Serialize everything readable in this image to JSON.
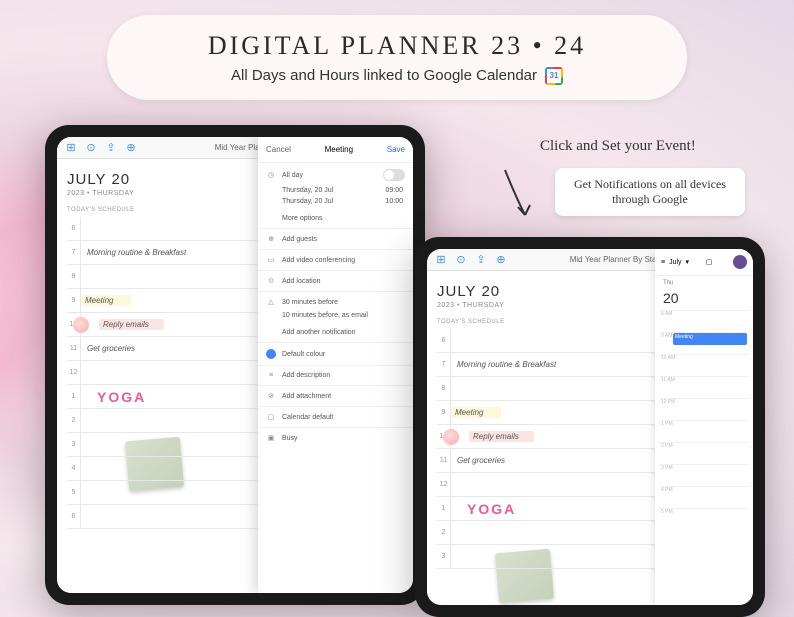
{
  "header": {
    "title": "DIGITAL PLANNER  23 • 24",
    "subtitle": "All Days and Hours linked to Google Calendar"
  },
  "callouts": {
    "click_set": "Click and Set your Event!",
    "notifications": "Get Notifications on all devices through Google"
  },
  "toolbar": {
    "app_title": "Mid Year Planner By Stay Planner"
  },
  "planner": {
    "date": "JULY 20",
    "date_sub": "2023 • THURSDAY",
    "schedule_label": "TODAY'S SCHEDULE",
    "hours": [
      "6",
      "7",
      "8",
      "9",
      "10",
      "11",
      "12",
      "1",
      "2",
      "3",
      "4",
      "5",
      "6"
    ],
    "tasks": {
      "7": "Morning routine & Breakfast",
      "9": "Meeting",
      "10": "Reply emails",
      "11": "Get groceries",
      "yoga": "YOGA"
    }
  },
  "modal": {
    "cancel": "Cancel",
    "title": "Meeting",
    "save": "Save",
    "all_day": "All day",
    "start": "Thursday, 20 Jul",
    "start_time": "09:00",
    "end": "Thursday, 20 Jul",
    "end_time": "10:00",
    "more_options": "More options",
    "add_guests": "Add guests",
    "add_video": "Add video conferencing",
    "add_location": "Add location",
    "reminder_30": "30 minutes before",
    "reminder_10": "10 minutes before, as email",
    "add_notification": "Add another notification",
    "default_colour": "Default colour",
    "add_description": "Add description",
    "add_attachment": "Add attachment",
    "calendar_default": "Calendar default",
    "busy": "Busy"
  },
  "gcal": {
    "month": "July",
    "day_label": "Thu",
    "day_num": "20",
    "event": "Meeting",
    "hours": [
      "8 AM",
      "9 AM",
      "10 AM",
      "11 AM",
      "12 PM",
      "1 PM",
      "2 PM",
      "3 PM",
      "4 PM",
      "5 PM"
    ]
  }
}
